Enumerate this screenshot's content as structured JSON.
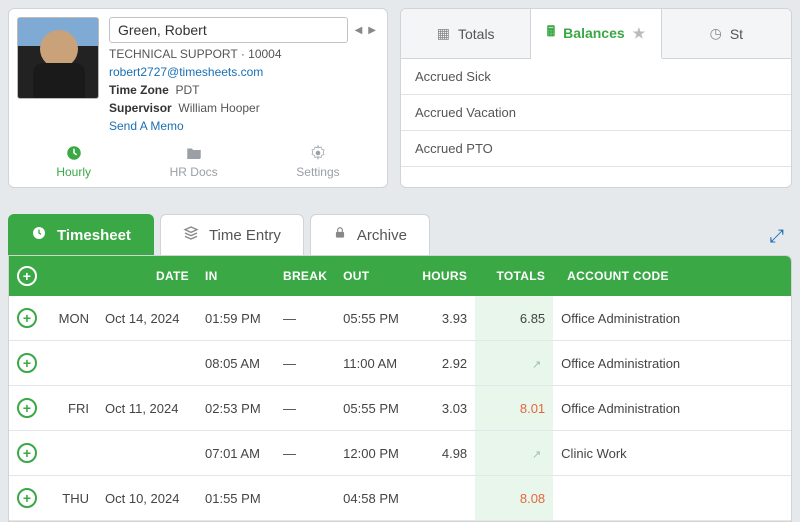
{
  "profile": {
    "name": "Green, Robert",
    "role": "TECHNICAL SUPPORT",
    "employee_id": "10004",
    "email": "robert2727@timesheets.com",
    "tz_label": "Time Zone",
    "tz_value": "PDT",
    "supervisor_label": "Supervisor",
    "supervisor_value": "William Hooper",
    "memo_link": "Send A Memo",
    "tabs": {
      "hourly": "Hourly",
      "hrdocs": "HR Docs",
      "settings": "Settings"
    }
  },
  "balance_tabs": {
    "totals": "Totals",
    "balances": "Balances",
    "status": "St"
  },
  "balances": {
    "items": [
      {
        "label": "Accrued Sick"
      },
      {
        "label": "Accrued Vacation"
      },
      {
        "label": "Accrued PTO"
      }
    ]
  },
  "sheet_tabs": {
    "timesheet": "Timesheet",
    "time_entry": "Time Entry",
    "archive": "Archive"
  },
  "ts_headers": {
    "date": "DATE",
    "in": "IN",
    "break": "BREAK",
    "out": "OUT",
    "hours": "HOURS",
    "totals": "TOTALS",
    "account": "ACCOUNT CODE"
  },
  "rows": [
    {
      "day": "MON",
      "date": "Oct 14, 2024",
      "in": "01:59 PM",
      "break": "—",
      "out": "05:55 PM",
      "hours": "3.93",
      "arrow": "",
      "totals": "6.85",
      "totals_red": false,
      "account": "Office Administration"
    },
    {
      "day": "",
      "date": "",
      "in": "08:05 AM",
      "break": "—",
      "out": "11:00 AM",
      "hours": "2.92",
      "arrow": "↗",
      "totals": "",
      "totals_red": false,
      "account": "Office Administration"
    },
    {
      "day": "FRI",
      "date": "Oct 11, 2024",
      "in": "02:53 PM",
      "break": "—",
      "out": "05:55 PM",
      "hours": "3.03",
      "arrow": "",
      "totals": "8.01",
      "totals_red": true,
      "account": "Office Administration"
    },
    {
      "day": "",
      "date": "",
      "in": "07:01 AM",
      "break": "—",
      "out": "12:00 PM",
      "hours": "4.98",
      "arrow": "↗",
      "totals": "",
      "totals_red": false,
      "account": "Clinic Work"
    },
    {
      "day": "THU",
      "date": "Oct 10, 2024",
      "in": "01:55 PM",
      "break": "",
      "out": "04:58 PM",
      "hours": "",
      "arrow": "",
      "totals": "8.08",
      "totals_red": true,
      "account": ""
    }
  ]
}
